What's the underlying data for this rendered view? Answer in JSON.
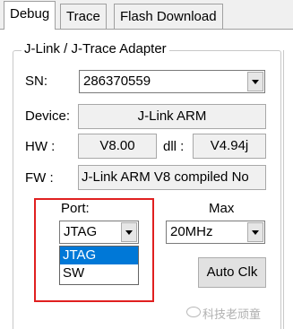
{
  "tabs": [
    {
      "label": "Debug",
      "active": true
    },
    {
      "label": "Trace",
      "active": false
    },
    {
      "label": "Flash Download",
      "active": false
    }
  ],
  "adapter": {
    "group_title": "J-Link / J-Trace Adapter",
    "sn_label": "SN:",
    "sn_value": "286370559",
    "device_label": "Device:",
    "device_value": "J-Link ARM",
    "hw_label": "HW :",
    "hw_value": "V8.00",
    "dll_label": "dll :",
    "dll_value": "V4.94j",
    "fw_label": "FW :",
    "fw_value": "J-Link ARM V8 compiled No"
  },
  "port": {
    "label": "Port:",
    "selected": "JTAG",
    "options": [
      "JTAG",
      "SW"
    ]
  },
  "max": {
    "label": "Max",
    "selected": "20MHz"
  },
  "auto_clk_label": "Auto Clk",
  "watermark": "科技老顽童",
  "colors": {
    "selection": "#0078d7",
    "highlight_box": "#e02020"
  }
}
